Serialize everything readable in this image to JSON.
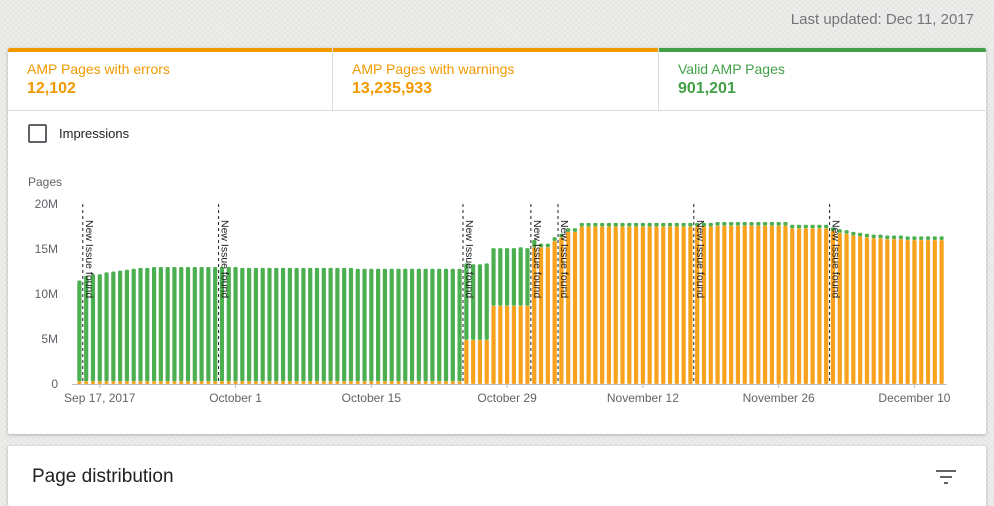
{
  "header": {
    "last_updated": "Last updated: Dec 11, 2017"
  },
  "tabs": [
    {
      "label": "AMP Pages with errors",
      "value": "12,102",
      "color": "#f29900"
    },
    {
      "label": "AMP Pages with warnings",
      "value": "13,235,933",
      "color": "#f29900"
    },
    {
      "label": "Valid AMP Pages",
      "value": "901,201",
      "color": "#43a047"
    }
  ],
  "impressions": {
    "label": "Impressions",
    "checked": false
  },
  "second_card": {
    "title": "Page distribution",
    "filter_icon": "filter-icon"
  },
  "colors": {
    "valid": "#4caf50",
    "warning": "#f9a21d",
    "error": "#e8710a",
    "annotation": "#202124",
    "axis": "#bdbdbd"
  },
  "chart_data": {
    "type": "bar",
    "stacked": true,
    "ylabel": "Pages",
    "ylim": [
      0,
      20000000
    ],
    "y_ticks": [
      0,
      5000000,
      10000000,
      15000000,
      20000000
    ],
    "y_tick_labels": [
      "0",
      "5M",
      "10M",
      "15M",
      "20M"
    ],
    "x_tick_labels": [
      {
        "index": 3,
        "label": "Sep 17, 2017"
      },
      {
        "index": 23,
        "label": "October 1"
      },
      {
        "index": 43,
        "label": "October 15"
      },
      {
        "index": 63,
        "label": "October 29"
      },
      {
        "index": 83,
        "label": "November 12"
      },
      {
        "index": 103,
        "label": "November 26"
      },
      {
        "index": 123,
        "label": "December 10"
      }
    ],
    "annotations": [
      {
        "index": 1,
        "text": "New Issue found"
      },
      {
        "index": 21,
        "text": "New Issue found"
      },
      {
        "index": 57,
        "text": "New Issue found"
      },
      {
        "index": 67,
        "text": "New Issue found"
      },
      {
        "index": 71,
        "text": "New Issue found"
      },
      {
        "index": 91,
        "text": "New Issue found"
      },
      {
        "index": 111,
        "text": "New Issue found"
      }
    ],
    "series": [
      {
        "name": "AMP Pages with warnings",
        "values": [
          300000,
          300000,
          300000,
          300000,
          300000,
          300000,
          300000,
          300000,
          300000,
          300000,
          300000,
          300000,
          300000,
          300000,
          300000,
          300000,
          300000,
          300000,
          300000,
          300000,
          300000,
          300000,
          300000,
          300000,
          300000,
          300000,
          300000,
          300000,
          300000,
          300000,
          300000,
          300000,
          300000,
          300000,
          300000,
          300000,
          300000,
          300000,
          300000,
          300000,
          300000,
          300000,
          300000,
          300000,
          300000,
          300000,
          300000,
          300000,
          300000,
          300000,
          300000,
          300000,
          300000,
          300000,
          300000,
          300000,
          300000,
          4900000,
          4900000,
          4900000,
          4900000,
          8700000,
          8700000,
          8700000,
          8700000,
          8700000,
          8700000,
          15200000,
          15200000,
          15200000,
          15900000,
          16300000,
          16900000,
          16900000,
          17500000,
          17500000,
          17500000,
          17500000,
          17500000,
          17500000,
          17500000,
          17500000,
          17500000,
          17500000,
          17500000,
          17500000,
          17500000,
          17500000,
          17500000,
          17500000,
          17500000,
          17500000,
          17500000,
          17500000,
          17600000,
          17600000,
          17600000,
          17600000,
          17600000,
          17600000,
          17600000,
          17600000,
          17600000,
          17600000,
          17600000,
          17300000,
          17300000,
          17300000,
          17300000,
          17300000,
          17300000,
          17000000,
          16800000,
          16700000,
          16500000,
          16400000,
          16300000,
          16200000,
          16200000,
          16100000,
          16100000,
          16100000,
          16000000,
          16000000,
          16000000,
          16000000,
          16000000,
          16000000
        ]
      },
      {
        "name": "Valid AMP Pages",
        "values": [
          11200000,
          11700000,
          11900000,
          11900000,
          12100000,
          12200000,
          12300000,
          12400000,
          12500000,
          12600000,
          12600000,
          12700000,
          12700000,
          12700000,
          12700000,
          12700000,
          12700000,
          12700000,
          12700000,
          12700000,
          12700000,
          12700000,
          12700000,
          12700000,
          12600000,
          12600000,
          12600000,
          12600000,
          12600000,
          12600000,
          12600000,
          12600000,
          12600000,
          12600000,
          12600000,
          12600000,
          12600000,
          12600000,
          12600000,
          12600000,
          12600000,
          12500000,
          12500000,
          12500000,
          12500000,
          12500000,
          12500000,
          12500000,
          12500000,
          12500000,
          12500000,
          12500000,
          12500000,
          12500000,
          12500000,
          12500000,
          12500000,
          8500000,
          8400000,
          8400000,
          8500000,
          6400000,
          6400000,
          6400000,
          6400000,
          6500000,
          6400000,
          800000,
          400000,
          400000,
          400000,
          400000,
          400000,
          400000,
          400000,
          400000,
          400000,
          400000,
          400000,
          400000,
          400000,
          400000,
          400000,
          400000,
          400000,
          400000,
          400000,
          400000,
          400000,
          400000,
          400000,
          400000,
          400000,
          400000,
          400000,
          400000,
          400000,
          400000,
          400000,
          400000,
          400000,
          400000,
          400000,
          400000,
          400000,
          400000,
          400000,
          400000,
          400000,
          400000,
          400000,
          400000,
          400000,
          400000,
          400000,
          400000,
          400000,
          400000,
          400000,
          400000,
          400000,
          400000,
          400000,
          400000,
          400000,
          400000,
          400000,
          400000
        ]
      }
    ]
  }
}
